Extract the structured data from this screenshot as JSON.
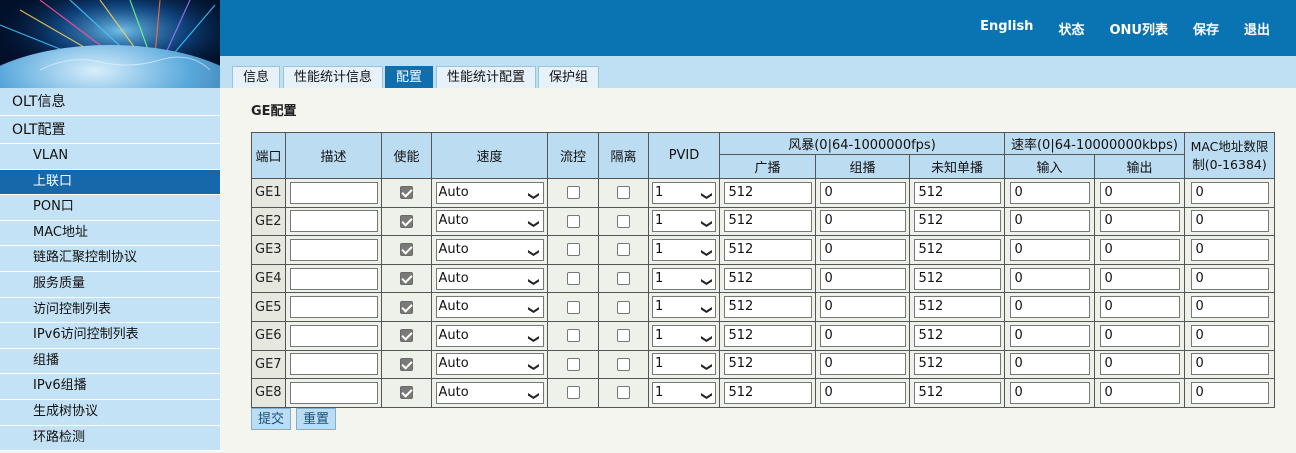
{
  "colors": {
    "topbar": "#0a74b2",
    "tabbar": "#bfdff2",
    "active": "#1768ab",
    "header_cell": "#bcdcf1"
  },
  "topnav": [
    "English",
    "状态",
    "ONU列表",
    "保存",
    "退出"
  ],
  "tabs": [
    {
      "label": "信息",
      "active": false
    },
    {
      "label": "性能统计信息",
      "active": false
    },
    {
      "label": "配置",
      "active": true
    },
    {
      "label": "性能统计配置",
      "active": false
    },
    {
      "label": "保护组",
      "active": false
    }
  ],
  "sidebar": [
    {
      "label": "OLT信息",
      "level": 0,
      "active": false
    },
    {
      "label": "OLT配置",
      "level": 0,
      "active": false
    },
    {
      "label": "VLAN",
      "level": 1,
      "active": false
    },
    {
      "label": "上联口",
      "level": 1,
      "active": true
    },
    {
      "label": "PON口",
      "level": 1,
      "active": false
    },
    {
      "label": "MAC地址",
      "level": 1,
      "active": false
    },
    {
      "label": "链路汇聚控制协议",
      "level": 1,
      "active": false
    },
    {
      "label": "服务质量",
      "level": 1,
      "active": false
    },
    {
      "label": "访问控制列表",
      "level": 1,
      "active": false
    },
    {
      "label": "IPv6访问控制列表",
      "level": 1,
      "active": false
    },
    {
      "label": "组播",
      "level": 1,
      "active": false
    },
    {
      "label": "IPv6组播",
      "level": 1,
      "active": false
    },
    {
      "label": "生成树协议",
      "level": 1,
      "active": false
    },
    {
      "label": "环路检测",
      "level": 1,
      "active": false
    }
  ],
  "section_title": "GE配置",
  "table": {
    "headers": {
      "port": "端口",
      "desc": "描述",
      "enable": "使能",
      "speed": "速度",
      "flow": "流控",
      "isolate": "隔离",
      "pvid": "PVID",
      "storm": "风暴(0|64-1000000fps)",
      "storm_sub": [
        "广播",
        "组播",
        "未知单播"
      ],
      "rate": "速率(0|64-10000000kbps)",
      "rate_sub": [
        "输入",
        "输出"
      ],
      "mac": "MAC地址数限制(0-16384)"
    },
    "rows": [
      {
        "port": "GE1",
        "desc": "",
        "enable": true,
        "speed": "Auto",
        "flow": false,
        "isolate": false,
        "pvid": "1",
        "broadcast": "512",
        "multicast": "0",
        "unknown": "512",
        "in": "0",
        "out": "0",
        "mac": "0"
      },
      {
        "port": "GE2",
        "desc": "",
        "enable": true,
        "speed": "Auto",
        "flow": false,
        "isolate": false,
        "pvid": "1",
        "broadcast": "512",
        "multicast": "0",
        "unknown": "512",
        "in": "0",
        "out": "0",
        "mac": "0"
      },
      {
        "port": "GE3",
        "desc": "",
        "enable": true,
        "speed": "Auto",
        "flow": false,
        "isolate": false,
        "pvid": "1",
        "broadcast": "512",
        "multicast": "0",
        "unknown": "512",
        "in": "0",
        "out": "0",
        "mac": "0"
      },
      {
        "port": "GE4",
        "desc": "",
        "enable": true,
        "speed": "Auto",
        "flow": false,
        "isolate": false,
        "pvid": "1",
        "broadcast": "512",
        "multicast": "0",
        "unknown": "512",
        "in": "0",
        "out": "0",
        "mac": "0"
      },
      {
        "port": "GE5",
        "desc": "",
        "enable": true,
        "speed": "Auto",
        "flow": false,
        "isolate": false,
        "pvid": "1",
        "broadcast": "512",
        "multicast": "0",
        "unknown": "512",
        "in": "0",
        "out": "0",
        "mac": "0"
      },
      {
        "port": "GE6",
        "desc": "",
        "enable": true,
        "speed": "Auto",
        "flow": false,
        "isolate": false,
        "pvid": "1",
        "broadcast": "512",
        "multicast": "0",
        "unknown": "512",
        "in": "0",
        "out": "0",
        "mac": "0"
      },
      {
        "port": "GE7",
        "desc": "",
        "enable": true,
        "speed": "Auto",
        "flow": false,
        "isolate": false,
        "pvid": "1",
        "broadcast": "512",
        "multicast": "0",
        "unknown": "512",
        "in": "0",
        "out": "0",
        "mac": "0"
      },
      {
        "port": "GE8",
        "desc": "",
        "enable": true,
        "speed": "Auto",
        "flow": false,
        "isolate": false,
        "pvid": "1",
        "broadcast": "512",
        "multicast": "0",
        "unknown": "512",
        "in": "0",
        "out": "0",
        "mac": "0"
      }
    ]
  },
  "buttons": {
    "submit": "提交",
    "reset": "重置"
  },
  "icons": {
    "dropdown": "chevron-down-icon",
    "checkbox": "checkbox-icon"
  }
}
